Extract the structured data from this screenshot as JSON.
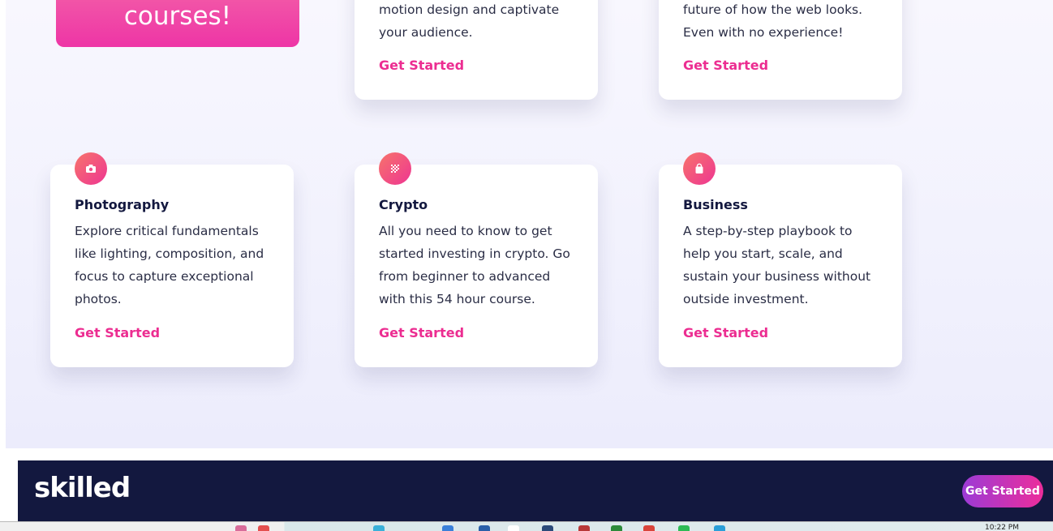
{
  "hero": {
    "cta_text": "courses!"
  },
  "cards_top": [
    {
      "desc": "motion design and captivate your audience.",
      "link": "Get Started"
    },
    {
      "desc": "future of how the web looks. Even with no experience!",
      "link": "Get Started"
    }
  ],
  "cards": [
    {
      "icon": "camera-icon",
      "title": "Photography",
      "desc": "Explore critical fundamentals like lighting, composition, and focus to capture exceptional photos.",
      "link": "Get Started"
    },
    {
      "icon": "crypto-icon",
      "title": "Crypto",
      "desc": "All you need to know to get started investing in crypto. Go from beginner to advanced with this 54 hour course.",
      "link": "Get Started"
    },
    {
      "icon": "shopping-bag-icon",
      "title": "Business",
      "desc": "A step-by-step playbook to help you start, scale, and sustain your business without outside investment.",
      "link": "Get Started"
    }
  ],
  "footer": {
    "logo": "skilled",
    "button": "Get Started"
  },
  "taskbar": {
    "clock": "10:22 PM"
  },
  "colors": {
    "accent": "#ec2d91",
    "navy": "#13183f",
    "gradient_start": "#9c3bd6",
    "gradient_end": "#ec2d9b"
  }
}
